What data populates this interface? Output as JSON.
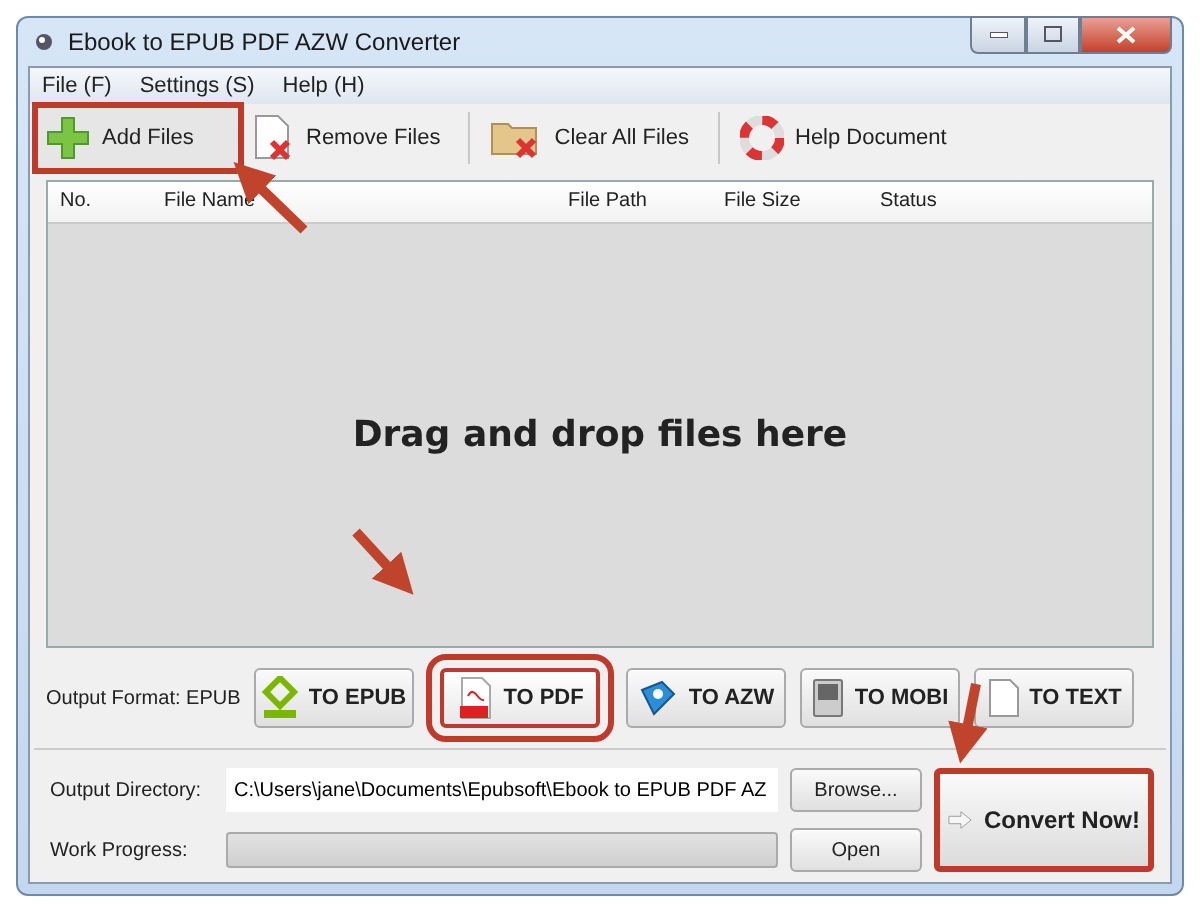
{
  "window": {
    "title": "Ebook to EPUB PDF AZW Converter"
  },
  "menu": [
    "File (F)",
    "Settings (S)",
    "Help (H)"
  ],
  "toolbar": [
    {
      "label": "Add Files",
      "kind": "add",
      "highlighted": true
    },
    {
      "label": "Remove Files",
      "kind": "remove",
      "highlighted": false
    },
    {
      "label": "Clear All Files",
      "kind": "clear",
      "highlighted": false
    },
    {
      "label": "Help Document",
      "kind": "help",
      "highlighted": false
    }
  ],
  "table": {
    "columns": [
      "No.",
      "File Name",
      "File Path",
      "File Size",
      "Status"
    ],
    "empty_message": "Drag and drop files here"
  },
  "output_format": {
    "label": "Output Format: EPUB",
    "buttons": [
      {
        "label": "TO EPUB",
        "kind": "epub",
        "highlighted": false
      },
      {
        "label": "TO PDF",
        "kind": "pdf",
        "highlighted": true
      },
      {
        "label": "TO AZW",
        "kind": "azw",
        "highlighted": false
      },
      {
        "label": "TO MOBI",
        "kind": "mobi",
        "highlighted": false
      },
      {
        "label": "TO TEXT",
        "kind": "text",
        "highlighted": false
      }
    ]
  },
  "output_directory": {
    "label": "Output Directory:",
    "value": "C:\\Users\\jane\\Documents\\Epubsoft\\Ebook to EPUB PDF AZ",
    "button": "Browse..."
  },
  "work_progress": {
    "label": "Work Progress:",
    "level": 0,
    "button": "Open"
  },
  "convert_button": {
    "label": "Convert Now!",
    "highlighted": true
  }
}
